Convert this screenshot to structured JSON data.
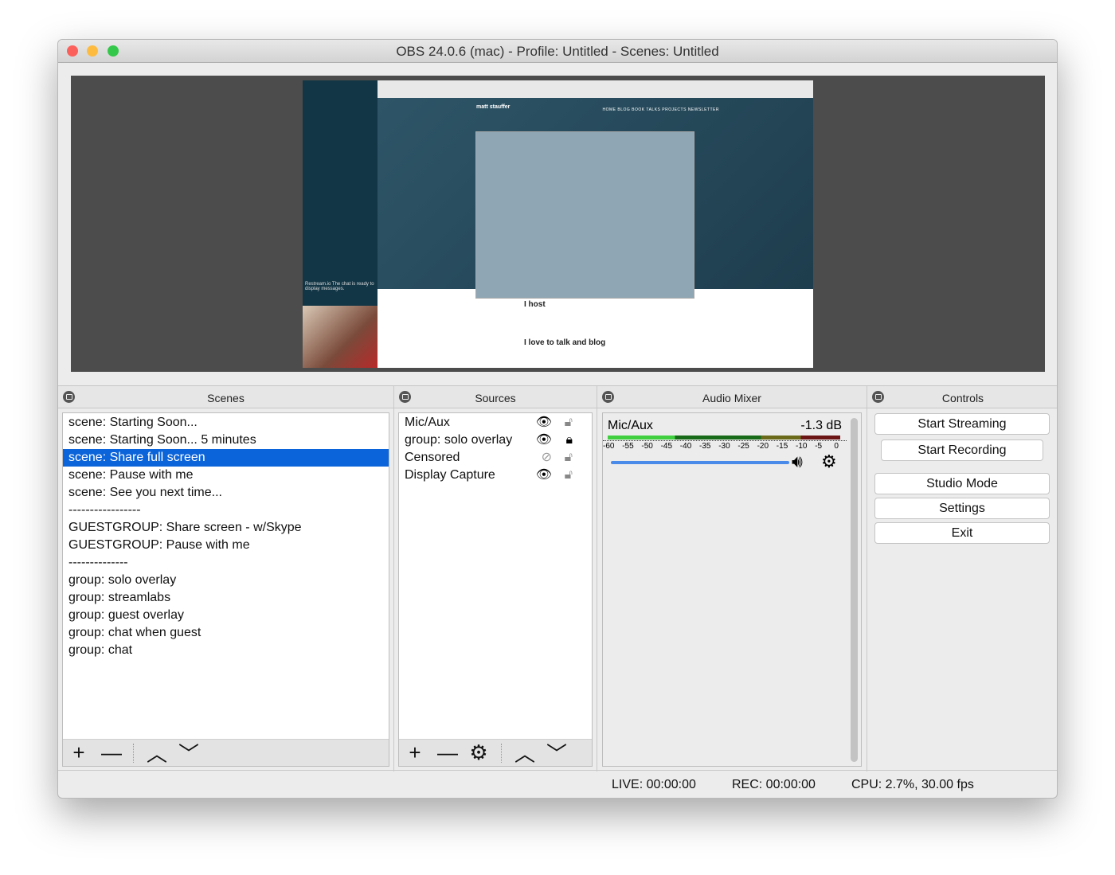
{
  "window": {
    "title": "OBS 24.0.6 (mac) - Profile: Untitled - Scenes: Untitled"
  },
  "preview": {
    "site_logo": "matt stauffer",
    "nav": "HOME   BLOG   BOOK   TALKS   PROJECTS   NEWSLETTER",
    "chat_text": "Restream.io The chat is ready to display messages.",
    "host_heading": "I host",
    "blog_heading": "I love to talk and blog"
  },
  "scenes": {
    "title": "Scenes",
    "items": [
      "scene: Starting Soon...",
      "scene: Starting Soon... 5 minutes",
      "scene: Share full screen",
      "scene: Pause with me",
      "scene: See you next time...",
      "-----------------",
      "GUESTGROUP: Share screen - w/Skype",
      "GUESTGROUP: Pause with me",
      "--------------",
      "group: solo overlay",
      "group: streamlabs",
      "group: guest overlay",
      "group: chat when guest",
      "group: chat"
    ],
    "selected": 2
  },
  "sources": {
    "title": "Sources",
    "items": [
      {
        "name": "Mic/Aux",
        "visible": true,
        "locked": false
      },
      {
        "name": "group: solo overlay",
        "visible": true,
        "locked": true
      },
      {
        "name": "Censored",
        "visible": false,
        "locked": false
      },
      {
        "name": "Display Capture",
        "visible": true,
        "locked": false
      }
    ]
  },
  "mixer": {
    "title": "Audio Mixer",
    "channel": "Mic/Aux",
    "level": "-1.3 dB",
    "scale": [
      "-60",
      "-55",
      "-50",
      "-45",
      "-40",
      "-35",
      "-30",
      "-25",
      "-20",
      "-15",
      "-10",
      "-5",
      "0"
    ],
    "volume_fraction": 1.0
  },
  "controls": {
    "title": "Controls",
    "start_streaming": "Start Streaming",
    "start_recording": "Start Recording",
    "studio_mode": "Studio Mode",
    "settings": "Settings",
    "exit": "Exit"
  },
  "status": {
    "live": "LIVE: 00:00:00",
    "rec": "REC: 00:00:00",
    "cpu": "CPU: 2.7%, 30.00 fps"
  }
}
